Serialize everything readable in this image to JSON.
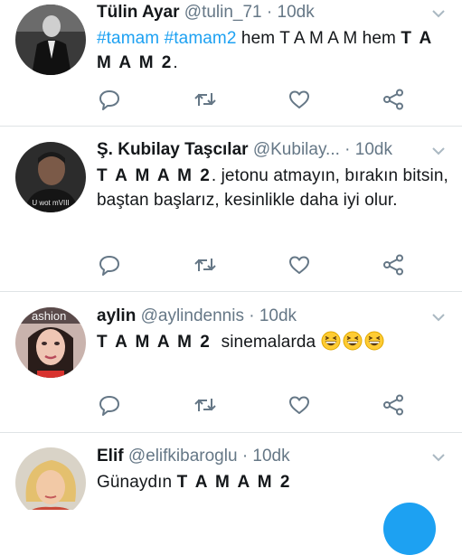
{
  "tweets": [
    {
      "name": "Tülin Ayar",
      "handle": "@tulin_71",
      "dot": "·",
      "time": "10dk",
      "segments": [
        {
          "text": "#tamam",
          "style": "tag"
        },
        {
          "text": " ",
          "style": "plain"
        },
        {
          "text": "#tamam2",
          "style": "tag"
        },
        {
          "text": " hem T A M A M hem ",
          "style": "plain"
        },
        {
          "text": "T A M A M 2",
          "style": "bold"
        },
        {
          "text": ".",
          "style": "plain"
        }
      ]
    },
    {
      "name": "Ş. Kubilay Taşcılar",
      "handle": "@Kubilay...",
      "dot": "·",
      "time": "10dk",
      "avatar_caption": "U wot mVIII",
      "segments": [
        {
          "text": "T A M A M 2",
          "style": "bold"
        },
        {
          "text": ". jetonu atmayın, bırakın bitsin, baştan başlarız, kesinlikle daha iyi olur.",
          "style": "plain"
        }
      ]
    },
    {
      "name": "aylin",
      "handle": "@aylindennis",
      "dot": "·",
      "time": "10dk",
      "avatar_caption": "ashion",
      "segments": [
        {
          "text": "T A M A M 2",
          "style": "bold"
        },
        {
          "text": "  sinemalarda ",
          "style": "plain"
        }
      ],
      "emojis": [
        "grinning-squinting-face",
        "grinning-squinting-face",
        "grinning-squinting-face"
      ]
    },
    {
      "name": "Elif",
      "handle": "@elifkibaroglu",
      "dot": "·",
      "time": "10dk",
      "segments": [
        {
          "text": "Günaydın ",
          "style": "plain"
        },
        {
          "text": "T A M A M 2",
          "style": "bold"
        }
      ]
    }
  ],
  "action_icons": [
    "reply-icon",
    "retweet-icon",
    "like-icon",
    "share-icon"
  ],
  "colors": {
    "link": "#1da1f2",
    "icon": "#657786",
    "name": "#14171a",
    "divider": "#dfe3e6"
  }
}
